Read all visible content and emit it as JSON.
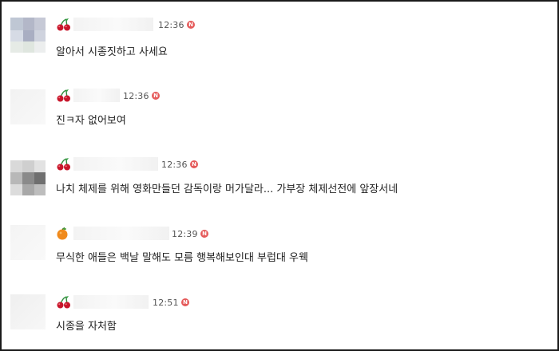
{
  "comments": [
    {
      "badge": "cherry-icon",
      "time": "12:36",
      "new_badge": "N",
      "text": "알아서 시종짓하고 사세요"
    },
    {
      "badge": "cherry-icon",
      "time": "12:36",
      "new_badge": "N",
      "text": "진ㅋ자 없어보여"
    },
    {
      "badge": "cherry-icon",
      "time": "12:36",
      "new_badge": "N",
      "text": "나치 체제를 위해 영화만들던 감독이랑 머가달라... 가부장 체제선전에 앞장서네"
    },
    {
      "badge": "orange-icon",
      "time": "12:39",
      "new_badge": "N",
      "text": "무식한 애들은 백날 말해도 모름 행복해보인대 부럽대 우웩"
    },
    {
      "badge": "cherry-icon",
      "time": "12:51",
      "new_badge": "N",
      "text": "시종을 자처함"
    }
  ],
  "colors": {
    "new_badge": "#e55a5a",
    "cherry": "#c8162b",
    "orange": "#f08a1c",
    "text": "#222222",
    "time": "#555555"
  }
}
